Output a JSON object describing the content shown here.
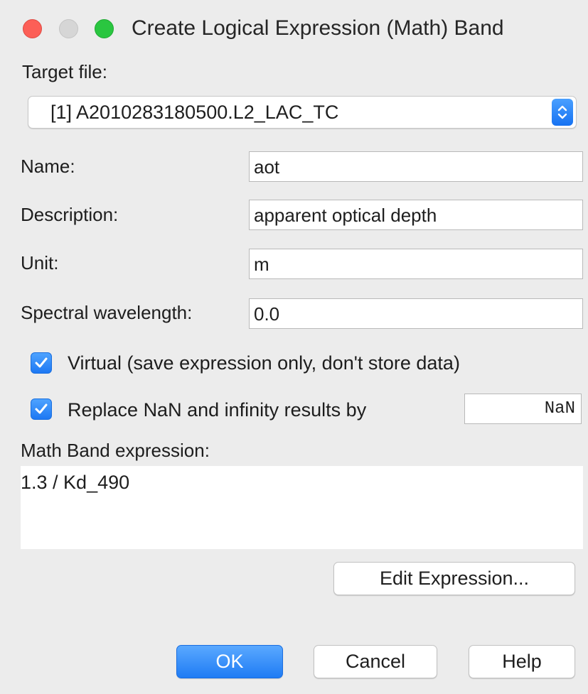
{
  "window": {
    "title": "Create Logical Expression (Math) Band"
  },
  "target_file": {
    "label": "Target file:",
    "selected": "[1] A2010283180500.L2_LAC_TC"
  },
  "fields": {
    "name": {
      "label": "Name:",
      "value": "aot"
    },
    "description": {
      "label": "Description:",
      "value": "apparent optical depth"
    },
    "unit": {
      "label": "Unit:",
      "value": "m"
    },
    "spectral_wavelength": {
      "label": "Spectral wavelength:",
      "value": "0.0"
    }
  },
  "options": {
    "virtual": {
      "label": "Virtual (save expression only, don't store data)",
      "checked": true
    },
    "replace_nan": {
      "label": "Replace NaN and infinity results by",
      "checked": true,
      "value": "NaN"
    }
  },
  "expression": {
    "label": "Math Band expression:",
    "value": "1.3 / Kd_490",
    "edit_button": "Edit Expression..."
  },
  "buttons": {
    "ok": "OK",
    "cancel": "Cancel",
    "help": "Help"
  },
  "colors": {
    "accent": "#1f7cf4",
    "close": "#fc5f57",
    "minimize_disabled": "#d6d6d6",
    "maximize": "#2ac640"
  }
}
